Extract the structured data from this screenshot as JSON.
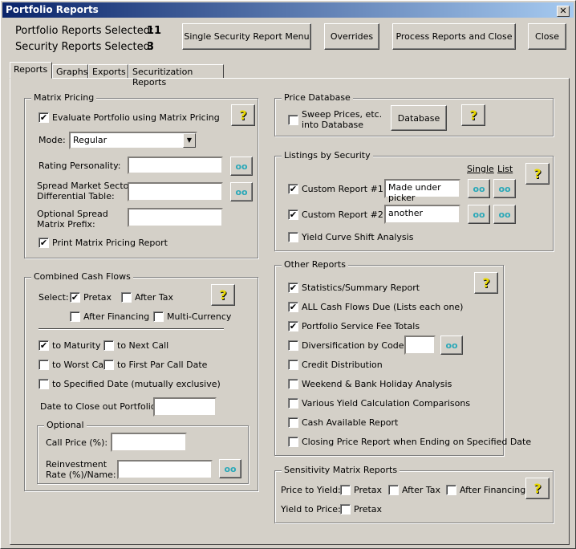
{
  "title": "Portfolio Reports",
  "close_x": "✕",
  "summary": {
    "portfolio_label": "Portfolio Reports Selected:",
    "portfolio_value": "11",
    "security_label": "Security Reports Selected:",
    "security_value": "3"
  },
  "buttons": {
    "single_menu": "Single Security Report Menu",
    "overrides": "Overrides",
    "process_close": "Process Reports and Close",
    "close": "Close",
    "database": "Database"
  },
  "tabs": [
    "Reports",
    "Graphs",
    "Exports",
    "Securitization Reports"
  ],
  "icons": {
    "help": "?",
    "glasses": "ᴏᴏ"
  },
  "matrix": {
    "title": "Matrix Pricing",
    "evaluate": "Evaluate Portfolio using Matrix Pricing",
    "mode_label": "Mode:",
    "mode_value": "Regular",
    "rating_label": "Rating Personality:",
    "rating_value": "",
    "spread_label1": "Spread Market Sector",
    "spread_label2": "Differential Table:",
    "spread_value": "",
    "prefix_label1": "Optional Spread",
    "prefix_label2": "Matrix Prefix:",
    "prefix_value": "",
    "print": "Print Matrix Pricing Report"
  },
  "ccf": {
    "title": "Combined Cash Flows",
    "select_label": "Select:",
    "pretax": "Pretax",
    "after_tax": "After Tax",
    "after_fin": "After Financing",
    "multi": "Multi-Currency",
    "to_maturity": "to Maturity",
    "to_next_call": "to Next Call",
    "to_worst": "to Worst Call",
    "to_first_par": "to First Par Call Date",
    "to_specified": "to Specified Date (mutually exclusive)",
    "close_out_label": "Date to Close out Portfolio:",
    "close_out_value": "",
    "optional": "Optional",
    "call_price_label": "Call Price (%):",
    "call_price_value": "",
    "reinv_label1": "Reinvestment",
    "reinv_label2": "Rate (%)/Name:",
    "reinv_value": ""
  },
  "price_db": {
    "title": "Price Database",
    "sweep1": "Sweep Prices, etc.",
    "sweep2": "into Database"
  },
  "listings": {
    "title": "Listings by Security",
    "single": "Single",
    "list": "List",
    "custom1_label": "Custom Report #1:",
    "custom1_value": "Made under picker",
    "custom2_label": "Custom Report #2:",
    "custom2_value": "another",
    "yield_curve": "Yield Curve Shift Analysis"
  },
  "other": {
    "title": "Other Reports",
    "items": [
      {
        "label": "Statistics/Summary Report",
        "checked": true
      },
      {
        "label": "ALL Cash Flows Due (Lists each one)",
        "checked": true
      },
      {
        "label": "Portfolio Service Fee Totals",
        "checked": true
      },
      {
        "label": "Diversification by Code:",
        "checked": false
      },
      {
        "label": "Credit Distribution",
        "checked": false
      },
      {
        "label": "Weekend & Bank Holiday Analysis",
        "checked": false
      },
      {
        "label": "Various Yield Calculation Comparisons",
        "checked": false
      },
      {
        "label": "Cash Available Report",
        "checked": false
      },
      {
        "label": "Closing Price Report when Ending on Specified Date",
        "checked": false
      }
    ],
    "div_value": ""
  },
  "sens": {
    "title": "Sensitivity Matrix Reports",
    "p2y": "Price to Yield:",
    "y2p": "Yield to Price:",
    "pretax": "Pretax",
    "after_tax": "After Tax",
    "after_fin": "After Financing"
  },
  "check": "✔"
}
